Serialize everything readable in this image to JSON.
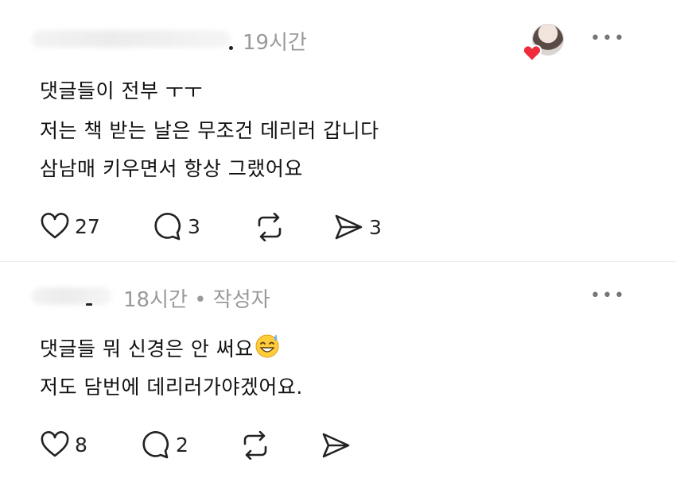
{
  "comments": [
    {
      "time": "19시간",
      "lines": [
        "댓글들이 전부 ㅜㅜ",
        "저는 책 받는 날은 무조건 데리러 갑니다",
        "삼남매 키우면서 항상 그랬어요"
      ],
      "likes": "27",
      "replies": "3",
      "shares": "3"
    },
    {
      "time": "18시간 • 작성자",
      "line1": "댓글들 뭐 신경은 안 써요",
      "line2": "저도 담번에 데리러가야겠어요.",
      "likes": "8",
      "replies": "2"
    }
  ],
  "more_label": "•••"
}
